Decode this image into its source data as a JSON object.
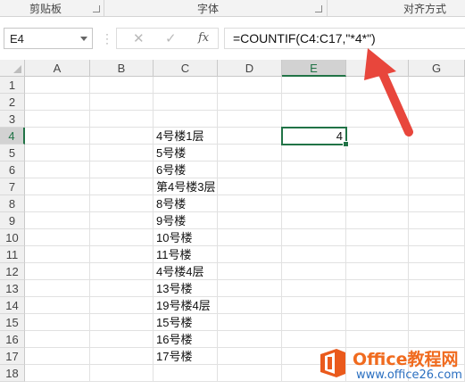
{
  "ribbon": {
    "groups": [
      "剪贴板",
      "字体",
      "对齐方式"
    ]
  },
  "namebox": {
    "value": "E4"
  },
  "formula_bar": {
    "cancel_icon": "✕",
    "enter_icon": "✓",
    "fx_label": "fx",
    "formula": "=COUNTIF(C4:C17,\"*4*\")"
  },
  "columns": [
    "A",
    "B",
    "C",
    "D",
    "E",
    "G"
  ],
  "rows": [
    "1",
    "2",
    "3",
    "4",
    "5",
    "6",
    "7",
    "8",
    "9",
    "10",
    "11",
    "12",
    "13",
    "14",
    "15",
    "16",
    "17",
    "18"
  ],
  "cells": {
    "C": [
      "",
      "",
      "",
      "4号楼1层",
      "5号楼",
      "6号楼",
      "第4号楼3层",
      "8号楼",
      "9号楼",
      "10号楼",
      "11号楼",
      "4号楼4层",
      "13号楼",
      "19号楼4层",
      "15号楼",
      "16号楼",
      "17号楼",
      ""
    ],
    "E4": "4"
  },
  "active_cell": "E4",
  "accent_color": "#217346",
  "annotation_color": "#e8463c",
  "watermark": {
    "brand": "Office教程网",
    "site": "www.office26.com"
  }
}
